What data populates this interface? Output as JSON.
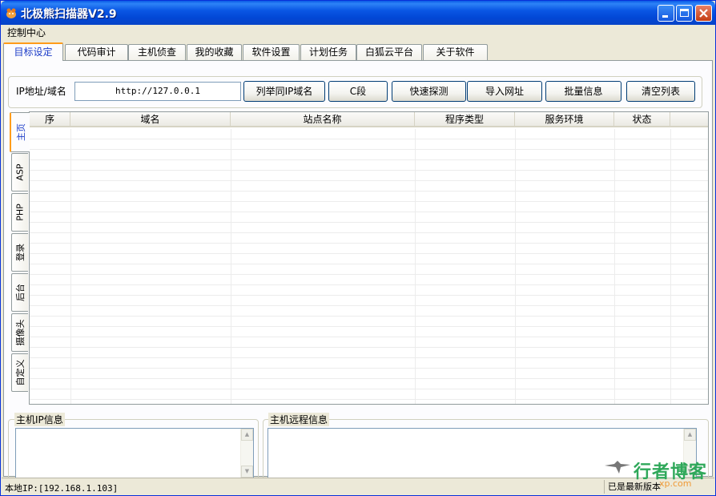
{
  "window": {
    "title": "北极熊扫描器V2.9",
    "colors": {
      "titlebar": "#0a5be6",
      "close": "#c43d13",
      "active_tab_accent": "#ff9c1a"
    }
  },
  "menu": {
    "items": [
      "控制中心"
    ]
  },
  "tabs": [
    "目标设定",
    "代码审计",
    "主机侦查",
    "我的收藏",
    "软件设置",
    "计划任务",
    "白狐云平台",
    "关于软件"
  ],
  "active_tab": "目标设定",
  "target": {
    "ip_label": "IP地址/域名",
    "ip_value": "http://127.0.0.1",
    "buttons": [
      "列举同IP域名",
      "C段",
      "快速探测",
      "导入网址",
      "批量信息",
      "清空列表"
    ]
  },
  "side_tabs": [
    "主页",
    "ASP",
    "PHP",
    "登录",
    "后台",
    "摄像头",
    "自定义"
  ],
  "active_side_tab": "主页",
  "table": {
    "columns": [
      "序",
      "域名",
      "站点名称",
      "程序类型",
      "服务环境",
      "状态"
    ],
    "rows": []
  },
  "host_ip": {
    "label": "主机IP信息",
    "value": ""
  },
  "host_remote": {
    "label": "主机远程信息",
    "value": ""
  },
  "status": {
    "local_ip": "本地IP:[192.168.1.103]",
    "version": "已是最新版本"
  },
  "watermark": {
    "text": "行者博客",
    "url": "xp.com"
  }
}
